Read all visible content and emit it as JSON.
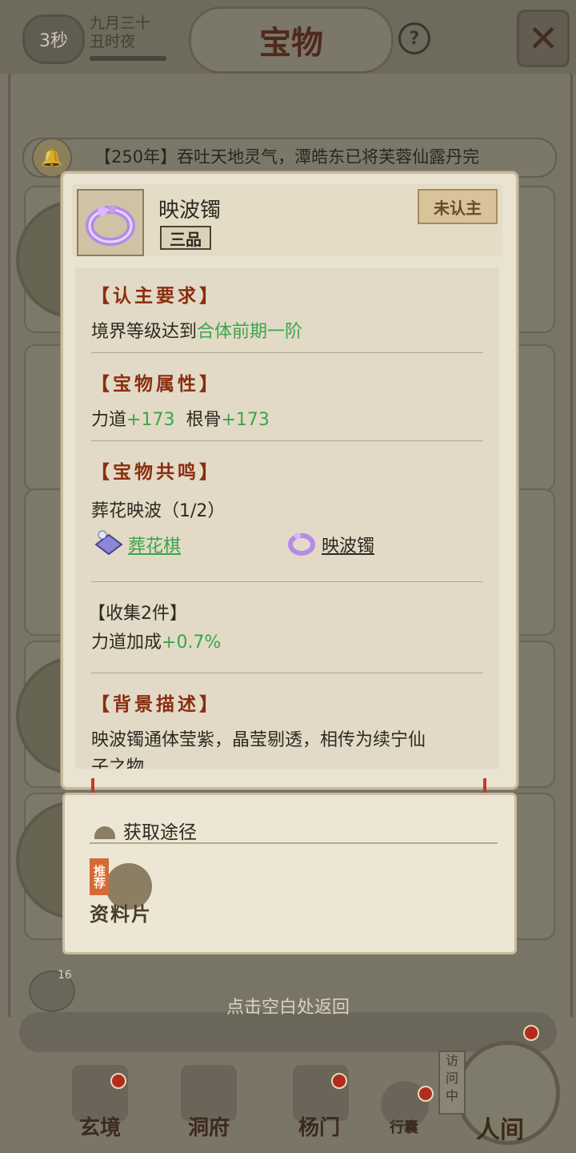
{
  "header": {
    "timer": "3秒",
    "date_line1": "九月三十",
    "date_line2": "丑时夜",
    "title": "宝物",
    "help_label": "?"
  },
  "banner": {
    "text": "【250年】吞吐天地灵气，潭皓东已将芙蓉仙露丹完"
  },
  "item": {
    "name": "映波镯",
    "grade": "三品",
    "status": "未认主",
    "icon": "purple-bracelet-icon"
  },
  "requirement": {
    "heading": "【认主要求】",
    "prefix": "境界等级达到",
    "value": "合体前期一阶"
  },
  "attributes": {
    "heading": "【宝物属性】",
    "items": [
      {
        "label": "力道",
        "value": "+173"
      },
      {
        "label": "根骨",
        "value": "+173"
      }
    ]
  },
  "resonance": {
    "heading": "【宝物共鸣】",
    "set_name": "葬花映波（1/2）",
    "pieces": [
      {
        "name": "葬花棋",
        "icon": "chess-treasure-icon",
        "color": "#3aa54a"
      },
      {
        "name": "映波镯",
        "icon": "purple-bracelet-icon",
        "color": "#2e2a22"
      }
    ],
    "bonus_heading": "【收集2件】",
    "bonus_label": "力道加成",
    "bonus_value": "+0.7%"
  },
  "background": {
    "heading": "【背景描述】",
    "text_line1": "映波镯通体莹紫，晶莹剔透，相传为续宁仙",
    "text_line2": "子之物"
  },
  "acquire": {
    "title": "获取途径",
    "source_tag": "推荐",
    "source_label": "资料片"
  },
  "hint": "点击空白处返回",
  "chat_count": "16",
  "nav": {
    "items": [
      "玄境",
      "洞府",
      "杨门",
      "行囊",
      "人间"
    ],
    "visit_label": "访问中"
  },
  "colors": {
    "accent_red": "#8a2e10",
    "positive_green": "#3aa54a",
    "panel_bg": "#eae3d1"
  }
}
